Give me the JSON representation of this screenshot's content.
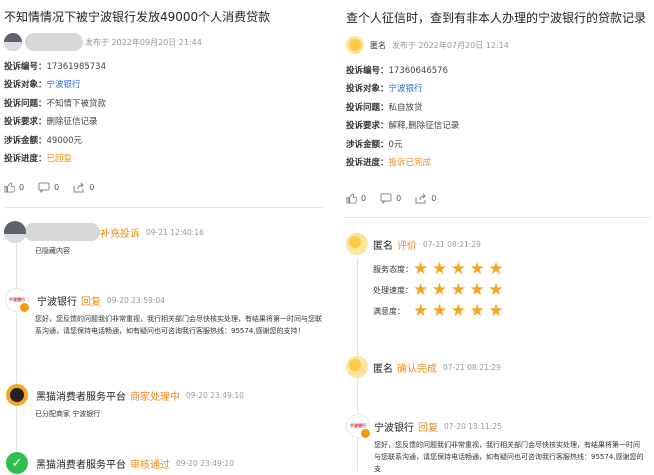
{
  "left": {
    "title": "不知情情况下被宁波银行发放49000个人消费贷款",
    "meta_time": "发布于 2022年09月20日 21:44",
    "fields": [
      {
        "key": "投诉编号：",
        "value": "17361985734",
        "style": "plain"
      },
      {
        "key": "投诉对象：",
        "value": "宁波银行",
        "style": "link"
      },
      {
        "key": "投诉问题：",
        "value": "不知情下被贷款",
        "style": "plain"
      },
      {
        "key": "投诉要求：",
        "value": "删除征信记录",
        "style": "plain"
      },
      {
        "key": "涉诉金额：",
        "value": "49000元",
        "style": "plain"
      },
      {
        "key": "投诉进度：",
        "value": "已回复",
        "style": "orange"
      }
    ],
    "actions": {
      "likes": "0",
      "comments": "0",
      "shares": "0"
    },
    "timeline": [
      {
        "name": "",
        "type": "补充投诉",
        "time": "09-21 12:40:16",
        "body": "已隐藏内容"
      },
      {
        "name": "宁波银行",
        "type": "回复",
        "time": "09-20 23:59:04",
        "body": "您好，您反馈的问题我们非常重视，我行相关部门会尽快核实处理，有结果将第一时间与您联系沟通，请您保持电话畅通，如有疑问也可咨询我行客服热线：95574,感谢您的支持！"
      },
      {
        "name": "黑猫消费者服务平台",
        "type": "商家处理中",
        "time": "09-20 23:49:10",
        "body": "已分配商家 宁波银行"
      },
      {
        "name": "黑猫消费者服务平台",
        "type": "审核通过",
        "time": "09-20 23:49:10",
        "body": ""
      }
    ],
    "bank_logo_text": "宁波银行"
  },
  "right": {
    "title": "查个人征信时，查到有非本人办理的宁波银行的贷款记录",
    "meta_name": "匿名",
    "meta_time": "发布于 2022年07月20日 12:14",
    "fields": [
      {
        "key": "投诉编号：",
        "value": "17360646576",
        "style": "plain"
      },
      {
        "key": "投诉对象：",
        "value": "宁波银行",
        "style": "link"
      },
      {
        "key": "投诉问题：",
        "value": "私自放贷",
        "style": "plain"
      },
      {
        "key": "投诉要求：",
        "value": "解释,删除征信记录",
        "style": "plain"
      },
      {
        "key": "涉诉金额：",
        "value": "0元",
        "style": "plain"
      },
      {
        "key": "投诉进度：",
        "value": "投诉已完成",
        "style": "orange"
      }
    ],
    "actions": {
      "likes": "0",
      "comments": "0",
      "shares": "0"
    },
    "timeline": [
      {
        "name": "匿名",
        "type": "评价",
        "time": "07-21 08:21:29"
      },
      {
        "name": "匿名",
        "type": "确认完成",
        "time": "07-21 08:21:29"
      },
      {
        "name": "宁波银行",
        "type": "回复",
        "time": "07-20 13:11:25",
        "body": "您好，您反馈的问题我们非常重视，我行相关部门会尽快核实处理，有结果将第一时间与您联系沟通，请您保持电话畅通，如有疑问也可咨询我行客服热线：95574,感谢您的支"
      }
    ],
    "ratings": [
      {
        "label": "服务态度：",
        "stars": 5
      },
      {
        "label": "处理速度：",
        "stars": 5
      },
      {
        "label": "满意度：",
        "stars": 5
      }
    ],
    "bank_logo_text": "宁波银行"
  },
  "colors": {
    "accent_orange": "#f08a1c",
    "link_blue": "#2b6cd6",
    "star": "#f5a623"
  },
  "icons": {
    "like": "thumbs-up-icon",
    "comment": "comment-icon",
    "share": "share-icon",
    "star": "star-icon"
  }
}
